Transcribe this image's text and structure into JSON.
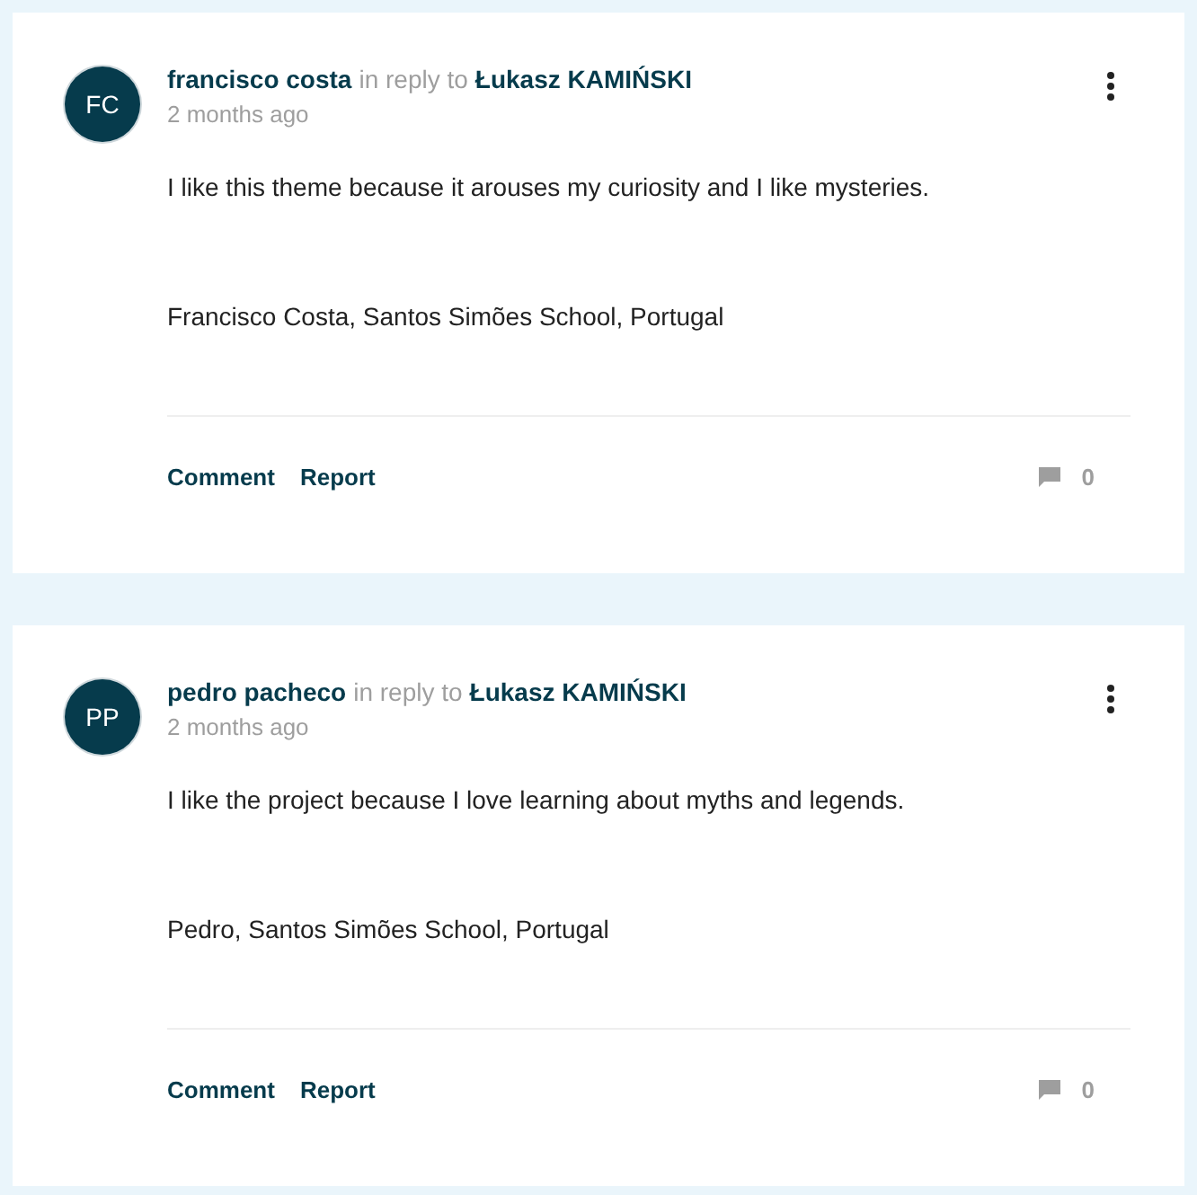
{
  "comments": [
    {
      "initials": "FC",
      "author": "francisco costa",
      "reply_label": "in reply to",
      "reply_to": "Łukasz KAMIŃSKI",
      "time": "2 months ago",
      "paragraphs": [
        "I like this theme because it arouses my curiosity and I like mysteries.",
        "Francisco Costa, Santos Simões School, Portugal"
      ],
      "actions": [
        "Comment",
        "Report"
      ],
      "reply_count": "0"
    },
    {
      "initials": "PP",
      "author": "pedro pacheco",
      "reply_label": "in reply to",
      "reply_to": "Łukasz KAMIŃSKI",
      "time": "2 months ago",
      "paragraphs": [
        "I like the project because I love learning about myths and legends.",
        "Pedro, Santos Simões School, Portugal"
      ],
      "actions": [
        "Comment",
        "Report"
      ],
      "reply_count": "0"
    }
  ]
}
